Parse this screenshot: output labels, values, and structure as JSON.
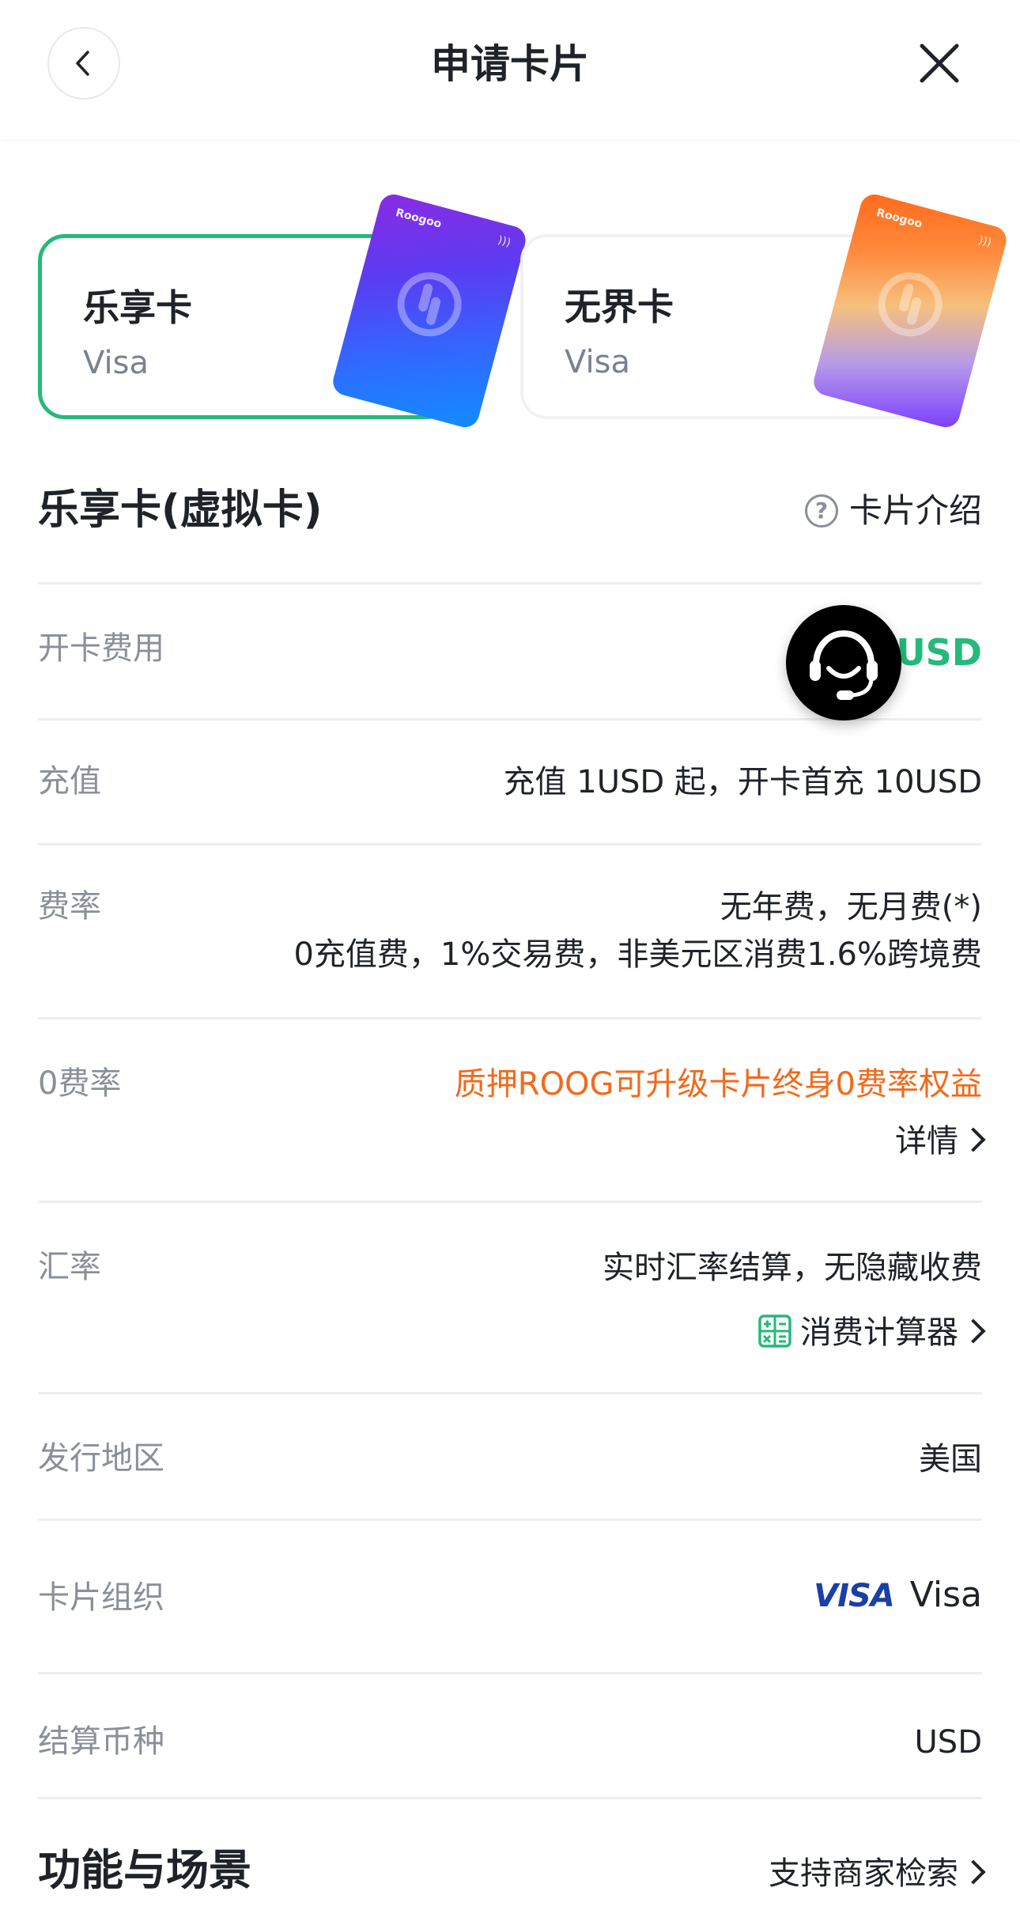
{
  "header": {
    "title": "申请卡片"
  },
  "cards": [
    {
      "name": "乐享卡",
      "network": "Visa",
      "active": true,
      "brand": "Roogoo"
    },
    {
      "name": "无界卡",
      "network": "Visa",
      "active": false,
      "brand": "Roogoo"
    }
  ],
  "section": {
    "title": "乐享卡(虚拟卡)",
    "intro_link": "卡片介绍"
  },
  "rows": {
    "open_fee": {
      "label": "开卡费用",
      "value": "USD"
    },
    "topup": {
      "label": "充值",
      "value": "充值 1USD 起，开卡首充 10USD"
    },
    "fee": {
      "label": "费率",
      "line1": "无年费，无月费(*)",
      "line2": "0充值费，1%交易费，非美元区消费1.6%跨境费"
    },
    "zero_fee": {
      "label": "0费率",
      "line1": "质押ROOG可升级卡片终身0费率权益",
      "link": "详情"
    },
    "rate": {
      "label": "汇率",
      "line1": "实时汇率结算，无隐藏收费",
      "link": "消费计算器"
    },
    "region": {
      "label": "发行地区",
      "value": "美国"
    },
    "org": {
      "label": "卡片组织",
      "logo_text": "VISA",
      "value": "Visa"
    },
    "currency": {
      "label": "结算币种",
      "value": "USD"
    }
  },
  "features": {
    "title": "功能与场景",
    "link": "支持商家检索"
  },
  "colors": {
    "accent": "#25b97a",
    "orange": "#f26a1b",
    "visa_blue": "#1a3fa6"
  }
}
